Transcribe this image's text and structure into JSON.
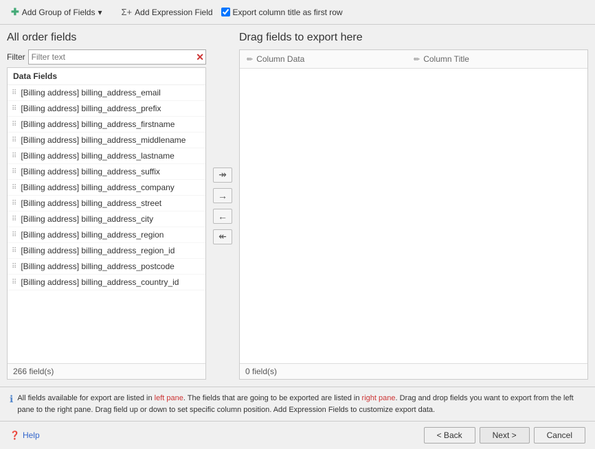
{
  "toolbar": {
    "add_group_label": "Add Group of Fields",
    "add_expression_label": "Add Expression Field",
    "export_checkbox_label": "Export column title as first row",
    "export_checkbox_checked": true
  },
  "left_pane": {
    "title": "All order fields",
    "filter_label": "Filter",
    "filter_placeholder": "Filter text",
    "group_header": "Data Fields",
    "fields": [
      "[Billing address] billing_address_email",
      "[Billing address] billing_address_prefix",
      "[Billing address] billing_address_firstname",
      "[Billing address] billing_address_middlename",
      "[Billing address] billing_address_lastname",
      "[Billing address] billing_address_suffix",
      "[Billing address] billing_address_company",
      "[Billing address] billing_address_street",
      "[Billing address] billing_address_city",
      "[Billing address] billing_address_region",
      "[Billing address] billing_address_region_id",
      "[Billing address] billing_address_postcode",
      "[Billing address] billing_address_country_id"
    ],
    "footer": "266 field(s)"
  },
  "right_pane": {
    "title": "Drag fields to export here",
    "col_header_data": "Column Data",
    "col_header_title": "Column Title",
    "footer": "0 field(s)"
  },
  "transfer_buttons": {
    "add_all": "↠",
    "add_selected": "→",
    "remove_selected": "←",
    "remove_all": "↞"
  },
  "info_bar": {
    "text_1": "All fields available for export are listed in left pane. The fields that are going to be exported are listed in right pane. Drag and drop fields you want to export",
    "text_2": "from the left pane to the right pane. Drag field up or down to set specific column position. Add Expression Fields to customize export data."
  },
  "bottom_bar": {
    "help_label": "Help",
    "back_label": "< Back",
    "next_label": "Next >",
    "cancel_label": "Cancel"
  }
}
